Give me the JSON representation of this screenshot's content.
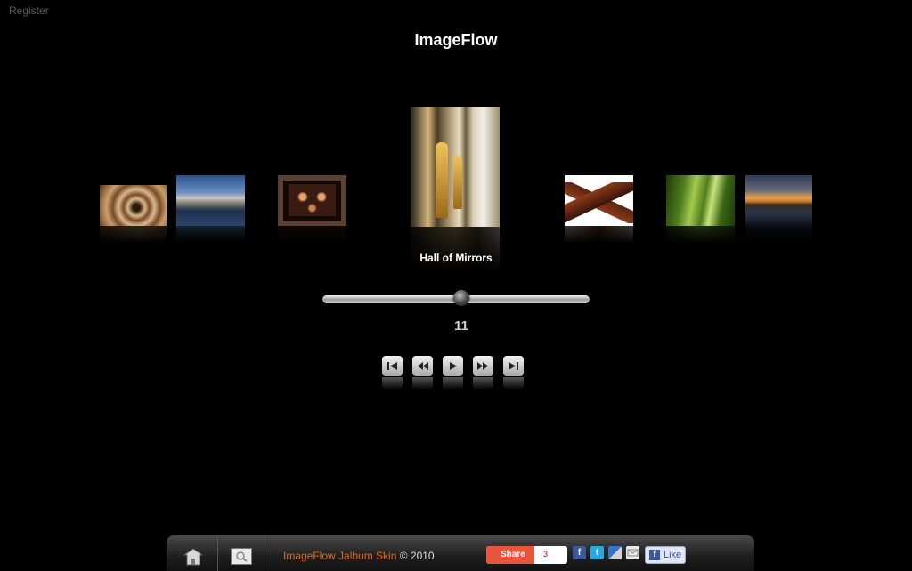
{
  "header": {
    "register_label": "Register",
    "title": "ImageFlow"
  },
  "gallery": {
    "thumbnails": [
      {
        "subject": "spiral staircase",
        "colors": [
          "#d8b98f",
          "#7a4a26",
          "#2a1708"
        ]
      },
      {
        "subject": "venice canal",
        "colors": [
          "#2a4f8f",
          "#6f93c4",
          "#1a2a40"
        ]
      },
      {
        "subject": "clock display",
        "colors": [
          "#3a1b12",
          "#b56a3a",
          "#120805"
        ]
      },
      {
        "subject": "hall of mirrors",
        "colors": [
          "#8b7a5a",
          "#d2b377",
          "#2b2416"
        ]
      },
      {
        "subject": "eiffel tower",
        "colors": [
          "#ffffff",
          "#8a3a1a",
          "#3a1408"
        ]
      },
      {
        "subject": "green leaf",
        "colors": [
          "#a4c94e",
          "#4f7d1e",
          "#1d3a09"
        ]
      },
      {
        "subject": "sunset lake",
        "colors": [
          "#2b3c56",
          "#c77a2a",
          "#0b0f18"
        ]
      }
    ],
    "caption": "Hall of Mirrors"
  },
  "slider": {
    "position": 0.52
  },
  "counter": "11",
  "controls": [
    {
      "name": "first-button",
      "icon": "skip-back-icon"
    },
    {
      "name": "previous-button",
      "icon": "rewind-icon"
    },
    {
      "name": "play-button",
      "icon": "play-icon"
    },
    {
      "name": "next-button",
      "icon": "fast-forward-icon"
    },
    {
      "name": "last-button",
      "icon": "skip-forward-icon"
    }
  ],
  "footer": {
    "credit_link": "ImageFlow Jalbum Skin",
    "credit_text": "© 2010",
    "share_label": "Share",
    "share_count": "3",
    "like_label": "Like",
    "accent_color": "#e06a1a"
  }
}
